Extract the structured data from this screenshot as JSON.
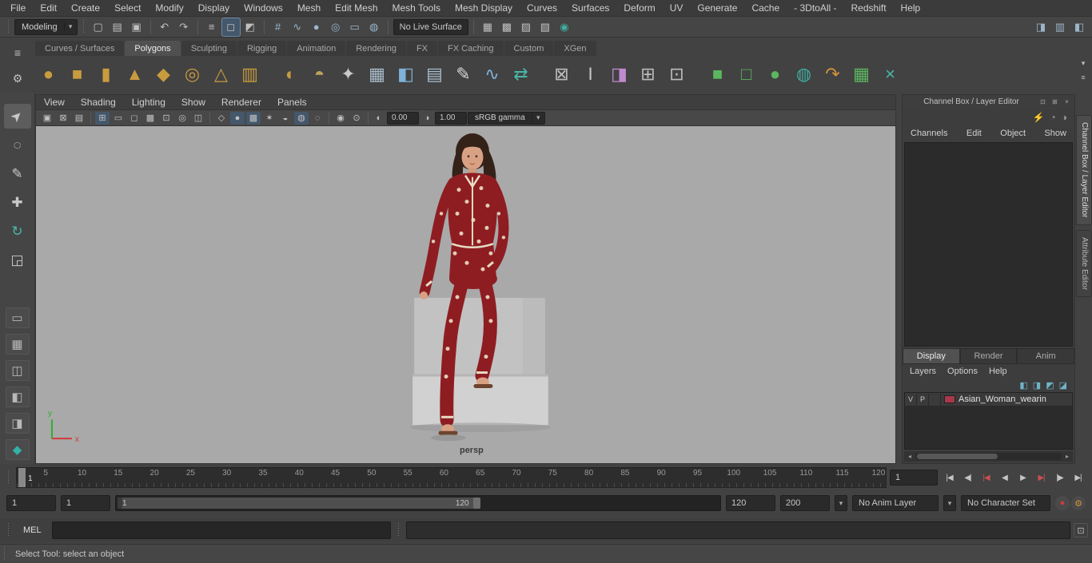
{
  "ui": {
    "chevron_down": "▾",
    "scroll_left": "◂",
    "scroll_right": "▸"
  },
  "menu_bar": {
    "items": [
      "File",
      "Edit",
      "Create",
      "Select",
      "Modify",
      "Display",
      "Windows",
      "Mesh",
      "Edit Mesh",
      "Mesh Tools",
      "Mesh Display",
      "Curves",
      "Surfaces",
      "Deform",
      "UV",
      "Generate",
      "Cache",
      "- 3DtoAll -",
      "Redshift",
      "Help"
    ]
  },
  "status_line": {
    "menuset_label": "Modeling",
    "live_surface_label": "No Live Surface",
    "file_icons": [
      {
        "name": "new-scene-icon",
        "glyph": "▢"
      },
      {
        "name": "open-scene-icon",
        "glyph": "▤"
      },
      {
        "name": "save-scene-icon",
        "glyph": "▣"
      }
    ],
    "history_icons": [
      {
        "name": "undo-icon",
        "glyph": "↶"
      },
      {
        "name": "redo-icon",
        "glyph": "↷"
      }
    ],
    "selection_icons": [
      {
        "name": "select-hierarchy-icon",
        "glyph": "≡"
      },
      {
        "name": "select-object-icon",
        "glyph": "◻",
        "active": true
      },
      {
        "name": "select-component-icon",
        "glyph": "◩"
      }
    ],
    "snap_icons": [
      {
        "name": "snap-grid-icon",
        "glyph": "#",
        "color": "#9ab6cc"
      },
      {
        "name": "snap-curve-icon",
        "glyph": "∿",
        "color": "#9ab6cc"
      },
      {
        "name": "snap-point-icon",
        "glyph": "●",
        "color": "#9ab6cc"
      },
      {
        "name": "snap-projected-center-icon",
        "glyph": "◎",
        "color": "#9ab6cc"
      },
      {
        "name": "snap-view-plane-icon",
        "glyph": "▭",
        "color": "#9ab6cc"
      },
      {
        "name": "make-live-icon",
        "glyph": "◍",
        "color": "#9ab6cc"
      }
    ],
    "render_icons": [
      {
        "name": "render-view-icon",
        "glyph": "▦"
      },
      {
        "name": "render-current-frame-icon",
        "glyph": "▩"
      },
      {
        "name": "ipr-render-icon",
        "glyph": "▨"
      },
      {
        "name": "render-settings-icon",
        "glyph": "▧"
      },
      {
        "name": "launch-render-icon",
        "glyph": "◉",
        "color": "#3fae9f"
      }
    ],
    "sidebar_icons": [
      {
        "name": "attribute-editor-toggle-icon",
        "glyph": "◨",
        "color": "#9ab6cc"
      },
      {
        "name": "tool-settings-toggle-icon",
        "glyph": "▥",
        "color": "#9ab6cc"
      },
      {
        "name": "channel-box-toggle-icon",
        "glyph": "◧",
        "color": "#9ab6cc"
      }
    ]
  },
  "shelf": {
    "left_icons": [
      {
        "name": "shelf-menu-icon",
        "glyph": "≡"
      },
      {
        "name": "shelf-gear-icon",
        "glyph": "⚙"
      }
    ],
    "right_icons": [
      {
        "name": "shelf-popup-icon",
        "glyph": "▾"
      },
      {
        "name": "shelf-list-icon",
        "glyph": "≡"
      }
    ],
    "tabs": [
      {
        "label": "Curves / Surfaces"
      },
      {
        "label": "Polygons",
        "active": true
      },
      {
        "label": "Sculpting"
      },
      {
        "label": "Rigging"
      },
      {
        "label": "Animation"
      },
      {
        "label": "Rendering"
      },
      {
        "label": "FX"
      },
      {
        "label": "FX Caching"
      },
      {
        "label": "Custom"
      },
      {
        "label": "XGen"
      }
    ],
    "icons": [
      {
        "name": "poly-sphere-icon",
        "glyph": "●",
        "color": "#c99b3f"
      },
      {
        "name": "poly-cube-icon",
        "glyph": "■",
        "color": "#c99b3f"
      },
      {
        "name": "poly-cylinder-icon",
        "glyph": "▮",
        "color": "#c99b3f"
      },
      {
        "name": "poly-cone-icon",
        "glyph": "▲",
        "color": "#c99b3f"
      },
      {
        "name": "poly-plane-icon",
        "glyph": "◆",
        "color": "#c99b3f"
      },
      {
        "name": "poly-torus-icon",
        "glyph": "◎",
        "color": "#c99b3f"
      },
      {
        "name": "poly-pyramid-icon",
        "glyph": "△",
        "color": "#c99b3f"
      },
      {
        "name": "poly-pipe-icon",
        "glyph": "▥",
        "color": "#c99b3f"
      },
      {
        "spacer": true
      },
      {
        "name": "smooth-sphere-icon",
        "glyph": "◐",
        "color": "#c99b3f"
      },
      {
        "name": "uv-sphere-icon",
        "glyph": "◓",
        "color": "#bfa05a"
      },
      {
        "name": "platonic-solid-icon",
        "glyph": "✦",
        "color": "#c9c9c9"
      },
      {
        "name": "plane-grid-icon",
        "glyph": "▦",
        "color": "#a9bccb"
      },
      {
        "name": "blue-cube-icon",
        "glyph": "◧",
        "color": "#7fb2d9"
      },
      {
        "name": "grid-plane-icon",
        "glyph": "▤",
        "color": "#a9bccb"
      },
      {
        "name": "pencil-curve-icon",
        "glyph": "✎",
        "color": "#d8d8d8"
      },
      {
        "name": "curve-tool-icon",
        "glyph": "∿",
        "color": "#7fb2d9"
      },
      {
        "name": "symmetry-icon",
        "glyph": "⇄",
        "color": "#49b8a8"
      },
      {
        "spacer": true
      },
      {
        "name": "lattice-icon",
        "glyph": "⊠",
        "color": "#bdbdbd"
      },
      {
        "name": "sculpt-icon",
        "glyph": "I",
        "color": "#c9c9c9"
      },
      {
        "name": "soft-mod-icon",
        "glyph": "◨",
        "color": "#c08ad0"
      },
      {
        "name": "cluster-icon",
        "glyph": "⊞",
        "color": "#bdbdbd"
      },
      {
        "name": "target-icon",
        "glyph": "⊡",
        "color": "#bdbdbd"
      },
      {
        "spacer": true
      },
      {
        "name": "combine-icon",
        "glyph": "■",
        "color": "#5cb660"
      },
      {
        "name": "separate-icon",
        "glyph": "□",
        "color": "#5cb660"
      },
      {
        "name": "smooth-mesh-icon",
        "glyph": "●",
        "color": "#5cb660"
      },
      {
        "name": "boolean-icon",
        "glyph": "◍",
        "color": "#3fae9f"
      },
      {
        "name": "mirror-icon",
        "glyph": "↷",
        "color": "#d2913c"
      },
      {
        "name": "quad-draw-icon",
        "glyph": "▦",
        "color": "#5cb660"
      },
      {
        "name": "multi-cut-icon",
        "glyph": "×",
        "color": "#49b8a8"
      }
    ]
  },
  "toolbox": {
    "tools": [
      {
        "name": "select-tool",
        "glyph": "➤",
        "active": true
      },
      {
        "name": "lasso-select-tool",
        "glyph": "◌"
      },
      {
        "name": "paint-select-tool",
        "glyph": "✎"
      },
      {
        "name": "move-tool",
        "glyph": "✚"
      },
      {
        "name": "rotate-tool",
        "glyph": "↻",
        "color": "#49b8a8"
      },
      {
        "name": "scale-tool",
        "glyph": "◲"
      }
    ],
    "layouts": [
      {
        "name": "single-pane-layout-button",
        "glyph": "▭"
      },
      {
        "name": "four-pane-layout-button",
        "glyph": "▦"
      },
      {
        "name": "persp-outliner-layout-button",
        "glyph": "◫"
      },
      {
        "name": "split-pane-layout-button",
        "glyph": "◧"
      },
      {
        "name": "hypershade-layout-button",
        "glyph": "◨"
      },
      {
        "name": "modeling-toolkit-icon",
        "glyph": "◆",
        "color": "#35b0a5"
      }
    ]
  },
  "viewport": {
    "menus": [
      "View",
      "Shading",
      "Lighting",
      "Show",
      "Renderer",
      "Panels"
    ],
    "icons": [
      {
        "name": "select-camera-icon",
        "glyph": "▣"
      },
      {
        "name": "lock-camera-icon",
        "glyph": "⊠"
      },
      {
        "name": "camera-attributes-icon",
        "glyph": "▤"
      },
      {
        "sep": true
      },
      {
        "name": "grid-toggle-icon",
        "glyph": "⊞",
        "active": true
      },
      {
        "name": "film-gate-icon",
        "glyph": "▭"
      },
      {
        "name": "resolution-gate-icon",
        "glyph": "◻"
      },
      {
        "name": "gate-mask-icon",
        "glyph": "▩"
      },
      {
        "name": "field-chart-icon",
        "glyph": "⊡"
      },
      {
        "name": "safe-action-icon",
        "glyph": "◎"
      },
      {
        "name": "safe-title-icon",
        "glyph": "◫"
      },
      {
        "sep": true
      },
      {
        "name": "wireframe-icon",
        "glyph": "◇"
      },
      {
        "name": "smooth-shade-icon",
        "glyph": "●",
        "active": true
      },
      {
        "name": "textured-icon",
        "glyph": "▩",
        "active": true
      },
      {
        "name": "lights-icon",
        "glyph": "✶"
      },
      {
        "name": "shadows-icon",
        "glyph": "◒"
      },
      {
        "name": "ao-icon",
        "glyph": "◍",
        "active": true
      },
      {
        "name": "motion-blur-icon",
        "glyph": "◌"
      },
      {
        "sep": true
      },
      {
        "name": "isolate-select-icon",
        "glyph": "◉"
      },
      {
        "name": "xray-icon",
        "glyph": "⊙"
      },
      {
        "sep": true
      }
    ],
    "exposure_icon": "◐",
    "exposure_value": "0.00",
    "gamma_icon": "◑",
    "gamma_value": "1.00",
    "colorspace": "sRGB gamma",
    "camera_label": "persp",
    "axis": {
      "y": "y",
      "x": "x"
    }
  },
  "channel_box": {
    "title": "Channel Box / Layer Editor",
    "header_icons": [
      {
        "name": "dock-icon",
        "glyph": "⊡"
      },
      {
        "name": "expand-icon",
        "glyph": "⊞"
      },
      {
        "name": "close-icon",
        "glyph": "×"
      }
    ],
    "toolbar_icons": [
      {
        "name": "channel-speed-icon",
        "glyph": "⚡",
        "color": "#d8b33a"
      },
      {
        "name": "channel-hyperbolic-icon",
        "glyph": "◔",
        "color": "#9a9a9a"
      },
      {
        "name": "channel-manip-icon",
        "glyph": "◑",
        "color": "#9a9a9a"
      }
    ],
    "menus": [
      "Channels",
      "Edit",
      "Object",
      "Show"
    ],
    "layer_editor": {
      "tabs": [
        {
          "label": "Display",
          "active": true
        },
        {
          "label": "Render"
        },
        {
          "label": "Anim"
        }
      ],
      "menus": [
        "Layers",
        "Options",
        "Help"
      ],
      "toolbar_icons": [
        {
          "name": "move-layer-up-icon",
          "glyph": "◧",
          "color": "#6fb3c9"
        },
        {
          "name": "move-layer-down-icon",
          "glyph": "◨",
          "color": "#6fb3c9"
        },
        {
          "name": "new-empty-layer-icon",
          "glyph": "◩",
          "color": "#6fb3c9"
        },
        {
          "name": "new-layer-from-selected-icon",
          "glyph": "◪",
          "color": "#6fb3c9"
        }
      ],
      "layer_row": {
        "visible": "V",
        "playback": "P",
        "name": "Asian_Woman_wearin",
        "swatch_color": "#a8384b"
      }
    }
  },
  "side_tabs": [
    {
      "label": "Channel Box / Layer Editor",
      "active": true
    },
    {
      "label": "Attribute Editor"
    }
  ],
  "time_slider": {
    "ticks": [
      5,
      10,
      15,
      20,
      25,
      30,
      35,
      40,
      45,
      50,
      55,
      60,
      65,
      70,
      75,
      80,
      85,
      90,
      95,
      100,
      105,
      110,
      115,
      120
    ],
    "current_frame": "1",
    "frame_field_value": "1",
    "playback_icons": [
      {
        "name": "go-to-start-button",
        "glyph": "|◀"
      },
      {
        "name": "step-back-frame-button",
        "glyph": "◀|"
      },
      {
        "name": "step-back-key-button",
        "glyph": "|◀",
        "color": "#c65050"
      },
      {
        "name": "play-backwards-button",
        "glyph": "◀"
      },
      {
        "name": "play-forwards-button",
        "glyph": "▶"
      },
      {
        "name": "step-forward-key-button",
        "glyph": "▶|",
        "color": "#c65050"
      },
      {
        "name": "step-forward-frame-button",
        "glyph": "|▶"
      },
      {
        "name": "go-to-end-button",
        "glyph": "▶|"
      }
    ]
  },
  "range_slider": {
    "anim_start": "1",
    "playback_start": "1",
    "bar_start": "1",
    "bar_end": "120",
    "playback_end": "120",
    "anim_end": "200",
    "anim_layer_label": "No Anim Layer",
    "character_set_label": "No Character Set",
    "right_icons": [
      {
        "name": "auto-keyframe-toggle",
        "glyph": "●",
        "color": "#cc3b3b"
      },
      {
        "name": "animation-preferences-icon",
        "glyph": "⚙",
        "color": "#d2913c"
      }
    ]
  },
  "command_line": {
    "label": "MEL"
  },
  "help_line": {
    "text": "Select Tool: select an object"
  }
}
